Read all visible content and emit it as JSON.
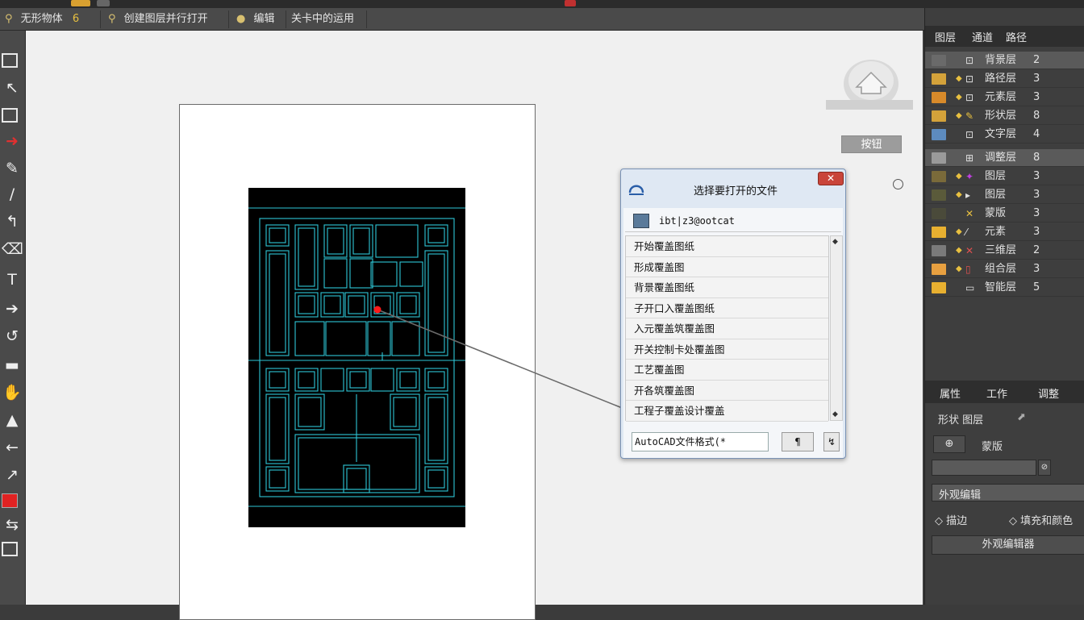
{
  "options_bar": {
    "items": [
      {
        "icon": "⚲",
        "label": "无形物体",
        "count": "6"
      },
      {
        "icon": "⚲",
        "label": "创建图层并行打开",
        "count": ""
      },
      {
        "icon": "●",
        "label": "编辑",
        "count": ""
      },
      {
        "icon": "",
        "label": "关卡中的运用",
        "count": ""
      }
    ]
  },
  "canvas": {
    "home_button_label": "按钮"
  },
  "dialog": {
    "title": "选择要打开的文件",
    "close_glyph": "✕",
    "path_text": "ibt|z3@ootcat",
    "items": [
      "开始覆盖图纸",
      "形成覆盖图",
      "背景覆盖图纸",
      "子开口入覆盖图纸",
      "入元覆盖筑覆盖图",
      "开关控制卡处覆盖图",
      "工艺覆盖图",
      "开各筑覆盖图",
      "工程子覆盖设计覆盖"
    ],
    "input_value": "AutoCAD文件格式(*",
    "btn1_label": "¶",
    "btn2_label": "↯"
  },
  "right_panel": {
    "tabs": [
      "图层",
      "通道",
      "路径"
    ],
    "layers": [
      {
        "name": "背景层",
        "count": "2",
        "swatch": "#6a6a6a",
        "highlight": true
      },
      {
        "name": "路径层",
        "count": "3",
        "swatch": "#d4a23a",
        "highlight": false
      },
      {
        "name": "元素层",
        "count": "3",
        "swatch": "#d88a2a",
        "highlight": false
      },
      {
        "name": "形状层",
        "count": "8",
        "swatch": "#d4a23a",
        "highlight": false
      },
      {
        "name": "文字层",
        "count": "4",
        "swatch": "#5d8bbf",
        "highlight": false
      },
      {
        "name": "调整层",
        "count": "8",
        "swatch": "#9a9a9a",
        "highlight": true
      },
      {
        "name": "图层",
        "count": "3",
        "swatch": "#7a6a3a",
        "highlight": false
      },
      {
        "name": "图层",
        "count": "3",
        "swatch": "#5a5a3a",
        "highlight": false
      },
      {
        "name": "蒙版",
        "count": "3",
        "swatch": "#4a4a3a",
        "highlight": false
      },
      {
        "name": "元素",
        "count": "3",
        "swatch": "#e8b030",
        "highlight": false
      },
      {
        "name": "三维层",
        "count": "2",
        "swatch": "#7a7a7a",
        "highlight": false
      },
      {
        "name": "组合层",
        "count": "3",
        "swatch": "#e8a040",
        "highlight": false
      },
      {
        "name": "智能层",
        "count": "5",
        "swatch": "#e8b030",
        "highlight": false
      }
    ],
    "tabs2": [
      "属性",
      "工作",
      "调整"
    ],
    "section_label": "形状 图层",
    "link_label": "蒙版",
    "sub_label": "外观编辑",
    "option1": "描边",
    "option2": "填充和颜色",
    "bottom_button": "外观编辑器"
  },
  "colors": {
    "accent": "#e8c040",
    "blueprint_line": "#2ec6d6",
    "red_marker": "#ff1a1a"
  }
}
